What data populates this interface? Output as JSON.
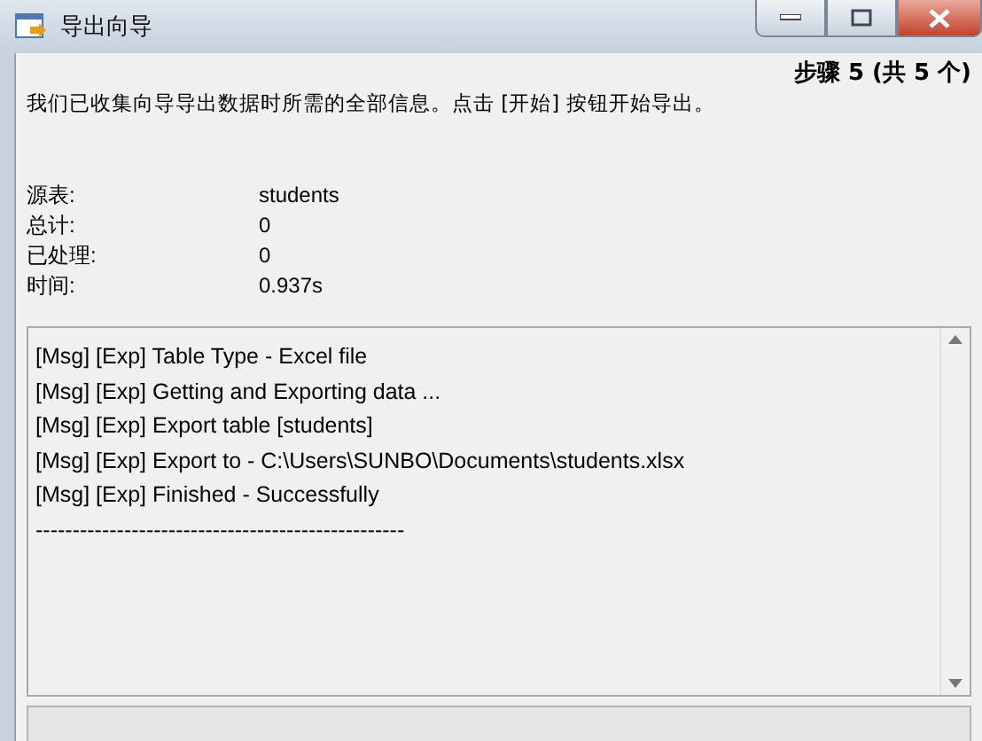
{
  "window": {
    "title": "导出向导"
  },
  "step": "步骤 5 (共 5 个)",
  "intro": "我们已收集向导导出数据时所需的全部信息。点击 [开始] 按钮开始导出。",
  "fields": [
    {
      "label": "源表:",
      "value": "students"
    },
    {
      "label": "总计:",
      "value": "0"
    },
    {
      "label": "已处理:",
      "value": "0"
    },
    {
      "label": "时间:",
      "value": "0.937s"
    }
  ],
  "log": [
    "[Msg] [Exp] Table Type - Excel file",
    "[Msg] [Exp] Getting and Exporting data ...",
    "[Msg] [Exp] Export table [students]",
    "[Msg] [Exp] Export to - C:\\Users\\SUNBO\\Documents\\students.xlsx",
    "[Msg] [Exp] Finished - Successfully",
    "--------------------------------------------------"
  ]
}
